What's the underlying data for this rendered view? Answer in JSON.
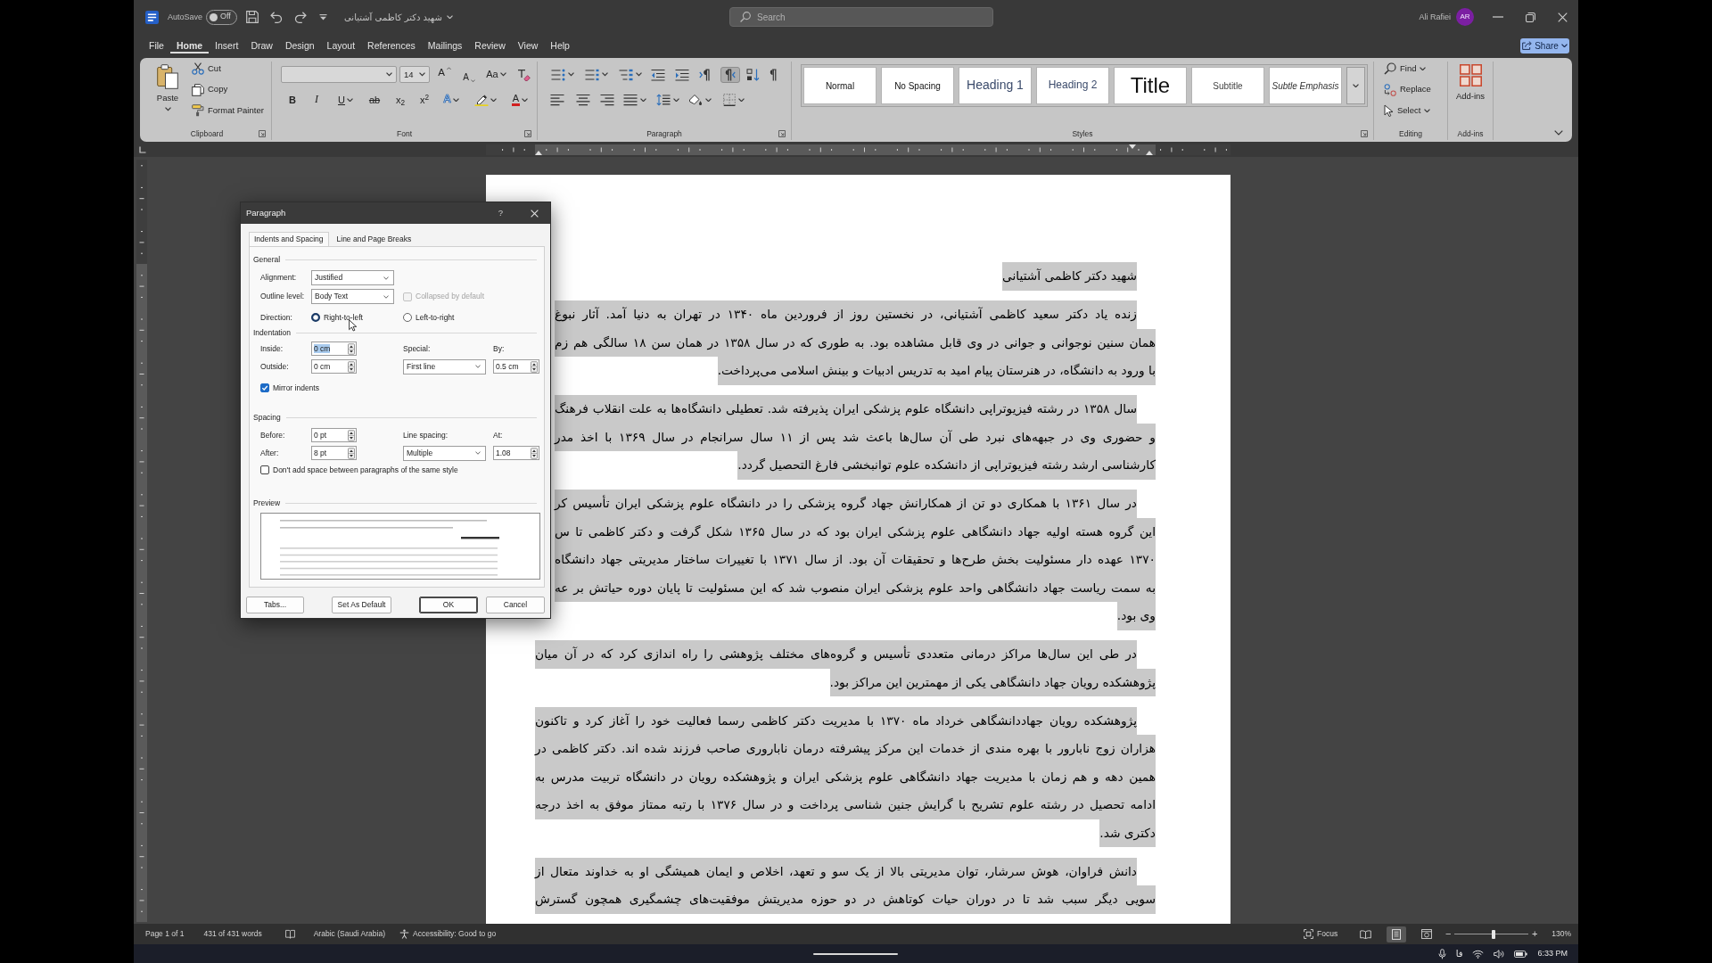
{
  "title_bar": {
    "autosave_label": "AutoSave",
    "autosave_toggle": {
      "label": "Off",
      "on": false
    },
    "document_title": "شهید دکتر کاظمی آشتیانی",
    "search": {
      "placeholder": "Search"
    },
    "user_name": "Ali Rafiei",
    "avatar_initials": "AR"
  },
  "ribbon_tabs": [
    {
      "label": "File",
      "selected": false
    },
    {
      "label": "Home",
      "selected": true
    },
    {
      "label": "Insert",
      "selected": false
    },
    {
      "label": "Draw",
      "selected": false
    },
    {
      "label": "Design",
      "selected": false
    },
    {
      "label": "Layout",
      "selected": false
    },
    {
      "label": "References",
      "selected": false
    },
    {
      "label": "Mailings",
      "selected": false
    },
    {
      "label": "Review",
      "selected": false
    },
    {
      "label": "View",
      "selected": false
    },
    {
      "label": "Help",
      "selected": false
    }
  ],
  "share_button": "Share",
  "ribbon": {
    "clipboard": {
      "paste": "Paste",
      "commands": [
        "Cut",
        "Copy",
        "Format Painter"
      ],
      "label": "Clipboard"
    },
    "font": {
      "size": "14",
      "grow": "A",
      "shrink": "A",
      "change_case": "Aa",
      "bold": "B",
      "italic": "I",
      "underline": "U",
      "strikethrough": "ab",
      "subscript": "x$_{2}$",
      "superscript": "x$^{2}$",
      "text_effects": "A",
      "font_color": "A",
      "label": "Font"
    },
    "paragraph": {
      "direction_buttons": [
        {
          "selected": false
        },
        {
          "selected": true
        }
      ],
      "label": "Paragraph"
    },
    "styles": {
      "items": [
        {
          "label": "Normal",
          "kind": "normal"
        },
        {
          "label": "No Spacing",
          "kind": "no-spacing"
        },
        {
          "label": "Heading 1",
          "kind": "heading-1"
        },
        {
          "label": "Heading 2",
          "kind": "heading-2"
        },
        {
          "label": "Title",
          "kind": "title"
        },
        {
          "label": "Subtitle",
          "kind": "subtitle"
        },
        {
          "label": "Subtle Emphasis",
          "kind": "subtle-emphasis"
        }
      ],
      "label": "Styles"
    },
    "editing": {
      "find": "Find",
      "replace": "Replace",
      "select": "Select",
      "label": "Editing"
    },
    "add_ins": {
      "button": "Add-ins",
      "label": "Add-ins"
    }
  },
  "document": {
    "selected": true,
    "title": "شهید دکتر کاظمی آشتیانی",
    "paragraphs": [
      {
        "lines": [
          "زنده یاد دکتر سعید کاظمی آشتیانی، در نخستین روز از فروردین ماه ۱۳۴۰ در تهران به دنیا آمد. آثار نبوغ",
          "همان سنین نوجوانی و جوانی در وی قابل مشاهده بود. به طوری که در سال ۱۳۵۸ در همان سن ۱۸ سالگی هم زم",
          "با ورود به دانشگاه، در هنرستان پیام امید به تدریس ادبیات و بینش اسلامی می‌پرداخت."
        ]
      },
      {
        "lines": [
          "سال ۱۳۵۸ در رشته فیزیوتراپی دانشگاه علوم پزشکی ایران پذیرفته شد. تعطیلی دانشگاه‌ها به علت انقلاب فرهنگ",
          "و حضوری وی در جبهه‌های نبرد طی آن سال‌ها باعث شد پس از ۱۱ سال سرانجام در سال ۱۳۶۹ با اخذ مدر",
          "کارشناسی ارشد رشته فیزیوتراپی از دانشکده علوم توانبخشی فارغ التحصیل گردد."
        ]
      },
      {
        "lines": [
          "در سال ۱۳۶۱ با همکاری دو تن از همکارانش جهاد گروه پزشکی را در دانشگاه علوم پزشکی ایران تأسیس کر",
          "این گروه هسته اولیه جهاد دانشگاهی علوم پزشکی ایران بود که در سال ۱۳۶۵ شکل گرفت و دکتر کاظمی تا س",
          "۱۳۷۰ عهده دار مسئولیت بخش طرح‌ها و تحقیقات آن بود. از سال ۱۳۷۱ با تغییرات ساختار مدیریتی جهاد دانشگاه",
          "به سمت ریاست جهاد دانشگاهی واحد علوم پزشکی ایران منصوب شد که این مسئولیت تا پایان دوره حیاتش بر عه",
          "وی بود."
        ]
      },
      {
        "lines": [
          "در طی این سال‌ها مراکز درمانی متعددی تأسیس و گروه‌های مختلف پژوهشی را راه اندازی کرد که در آن میان",
          "پژوهشکده رویان جهاد دانشگاهی یکی از مهمترین این مراکز بود."
        ]
      },
      {
        "lines": [
          "پژوهشکده رویان جهاددانشگاهی خرداد ماه ۱۳۷۰ با مدیریت دکتر کاظمی رسما فعالیت خود را آغاز کرد و تاکنون",
          "هزاران زوج نابارور با بهره مندی از خدمات این مرکز پیشرفته درمان ناباروری صاحب فرزند شده اند. دکتر کاظمی در",
          "همین دهه و هم زمان با مدیریت جهاد دانشگاهی علوم پزشکی ایران و پژوهشکده رویان در دانشگاه تربیت مدرس به",
          "ادامه تحصیل در رشته علوم تشریح با گرایش جنین شناسی پرداخت و در سال ۱۳۷۶ با رتبه ممتاز موفق به اخذ درجه",
          "دکتری شد."
        ]
      },
      {
        "lines": [
          "دانش فراوان، هوش سرشار، توان مدیریتی بالا از یک سو و تعهد، اخلاص و ایمان همیشگی او به خداوند متعال از",
          "سویی دیگر سبب شد تا در دوران حیات کوتاهش در دو حوزه مدیریتش موفقیت‌های چشمگیری همچون گسترش"
        ],
        "cut_off": true
      }
    ]
  },
  "dialog": {
    "title": "Paragraph",
    "help": "?",
    "tabs": [
      {
        "label": "Indents and Spacing",
        "selected": true
      },
      {
        "label": "Line and Page Breaks",
        "selected": false
      }
    ],
    "general": {
      "heading": "General",
      "alignment": {
        "label": "Alignment:",
        "value": "Justified"
      },
      "outline_level": {
        "label": "Outline level:",
        "value": "Body Text"
      },
      "collapsed": {
        "label": "Collapsed by default",
        "checked": false,
        "disabled": true
      },
      "direction": {
        "label": "Direction:",
        "options": [
          {
            "label": "Right-to-left",
            "selected": true
          },
          {
            "label": "Left-to-right",
            "selected": false
          }
        ]
      }
    },
    "indentation": {
      "heading": "Indentation",
      "inside": {
        "label": "Inside:",
        "value": "0 cm",
        "text_selected": true
      },
      "outside": {
        "label": "Outside:",
        "value": "0 cm"
      },
      "special": {
        "label": "Special:",
        "value": "First line"
      },
      "by": {
        "label": "By:",
        "value": "0.5 cm"
      },
      "mirror_indents": {
        "label": "Mirror indents",
        "checked": true
      }
    },
    "spacing": {
      "heading": "Spacing",
      "before": {
        "label": "Before:",
        "value": "0 pt"
      },
      "after": {
        "label": "After:",
        "value": "8 pt"
      },
      "line_spacing": {
        "label": "Line spacing:",
        "value": "Multiple"
      },
      "at": {
        "label": "At:",
        "value": "1.08"
      },
      "dont_add_space": {
        "label": "Don't add space between paragraphs of the same style",
        "checked": false
      }
    },
    "preview": {
      "heading": "Preview"
    },
    "buttons": [
      {
        "label": "Tabs...",
        "default": false
      },
      {
        "label": "Set As Default",
        "default": false
      },
      {
        "label": "OK",
        "default": true
      },
      {
        "label": "Cancel",
        "default": false
      }
    ]
  },
  "status_bar": {
    "page": "Page 1 of 1",
    "words": "431 of 431 words",
    "language": "Arabic (Saudi Arabia)",
    "accessibility": "Accessibility: Good to go",
    "focus": "Focus",
    "views": [
      {
        "kind": "read",
        "selected": false
      },
      {
        "kind": "print",
        "selected": true
      },
      {
        "kind": "web",
        "selected": false
      }
    ],
    "zoom_out": "−",
    "zoom": {
      "level": 0.53
    },
    "zoom_in": "+",
    "zoom_label": "130%"
  },
  "taskbar": {
    "input_language": "فا",
    "time": "6:33 PM"
  }
}
